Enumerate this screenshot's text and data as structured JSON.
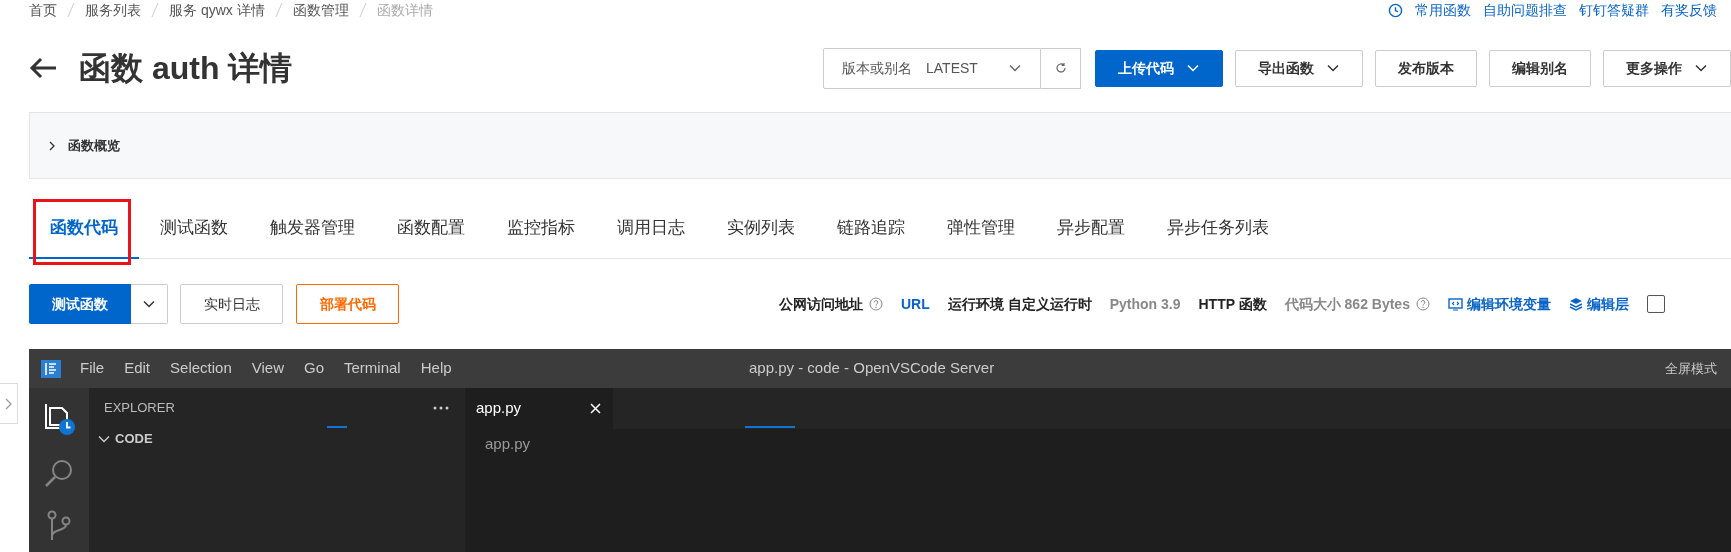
{
  "breadcrumb": [
    {
      "label": "首页",
      "current": false
    },
    {
      "label": "服务列表",
      "current": false
    },
    {
      "label": "服务 qywx 详情",
      "current": false
    },
    {
      "label": "函数管理",
      "current": false
    },
    {
      "label": "函数详情",
      "current": true
    }
  ],
  "help_links": [
    "常用函数",
    "自助问题排查",
    "钉钉答疑群",
    "有奖反馈"
  ],
  "page_title": "函数 auth 详情",
  "version_select": {
    "label": "版本或别名",
    "value": "LATEST"
  },
  "header_buttons": [
    {
      "label": "上传代码",
      "kind": "primary",
      "dropdown": true
    },
    {
      "label": "导出函数",
      "kind": "default",
      "dropdown": true
    },
    {
      "label": "发布版本",
      "kind": "default",
      "dropdown": false
    },
    {
      "label": "编辑别名",
      "kind": "default",
      "dropdown": false
    },
    {
      "label": "更多操作",
      "kind": "default",
      "dropdown": true
    }
  ],
  "overview": {
    "label": "函数概览",
    "expanded": false
  },
  "tabs": [
    {
      "label": "函数代码",
      "selected": true
    },
    {
      "label": "测试函数",
      "selected": false
    },
    {
      "label": "触发器管理",
      "selected": false
    },
    {
      "label": "函数配置",
      "selected": false
    },
    {
      "label": "监控指标",
      "selected": false
    },
    {
      "label": "调用日志",
      "selected": false
    },
    {
      "label": "实例列表",
      "selected": false
    },
    {
      "label": "链路追踪",
      "selected": false
    },
    {
      "label": "弹性管理",
      "selected": false
    },
    {
      "label": "异步配置",
      "selected": false
    },
    {
      "label": "异步任务列表",
      "selected": false
    }
  ],
  "action_buttons": [
    {
      "label": "测试函数",
      "kind": "primary-split"
    },
    {
      "label": "实时日志",
      "kind": "default"
    },
    {
      "label": "部署代码",
      "kind": "warning"
    }
  ],
  "info_items": [
    {
      "kind": "strong",
      "text": "公网访问地址",
      "help": true
    },
    {
      "kind": "link",
      "text": "URL",
      "help": false
    },
    {
      "kind": "strong",
      "text": "运行环境 自定义运行时",
      "help": false
    },
    {
      "kind": "muted",
      "text": "Python 3.9",
      "help": false
    },
    {
      "kind": "strong",
      "text": "HTTP 函数",
      "help": false
    },
    {
      "kind": "muted",
      "text": "代码大小 862 Bytes",
      "help": true
    },
    {
      "kind": "env-link",
      "text": "编辑环境变量",
      "help": false
    },
    {
      "kind": "layer-link",
      "text": "编辑层",
      "help": false
    },
    {
      "kind": "checkbox",
      "checked": false
    }
  ],
  "editor": {
    "menu": [
      "File",
      "Edit",
      "Selection",
      "View",
      "Go",
      "Terminal",
      "Help"
    ],
    "title": "app.py - code - OpenVSCode Server",
    "fullscreen": "全屏模式",
    "explorer_title": "EXPLORER",
    "folder": {
      "name": "CODE",
      "expanded": true
    },
    "tabs": [
      {
        "label": "app.py",
        "selected": true
      }
    ],
    "path": "app.py"
  }
}
